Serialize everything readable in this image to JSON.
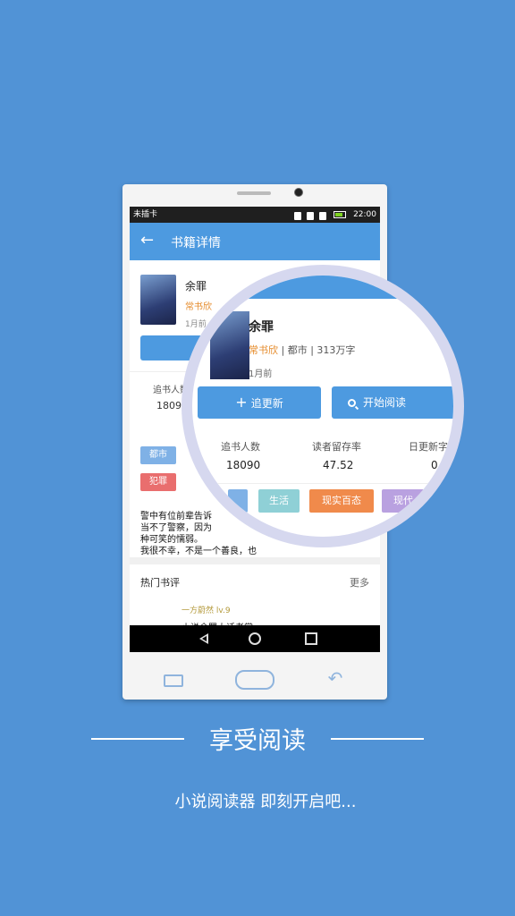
{
  "status_bar": {
    "carrier": "未插卡",
    "time": "22:00"
  },
  "app_bar": {
    "back_icon": "arrow-left-icon",
    "title": "书籍详情"
  },
  "book": {
    "title": "余罪",
    "author": "常书欣",
    "genre": "都市",
    "length": "313万字",
    "updated": "1月前",
    "stats": [
      {
        "label": "追书人数",
        "value": "18090"
      },
      {
        "label": "读者留存率",
        "value": "47.52"
      },
      {
        "label": "日更新字",
        "value": "0"
      }
    ],
    "tags": [
      {
        "label": "都市",
        "color": "#7fb1e6"
      },
      {
        "label": "犯罪",
        "color": "#e96e6e"
      },
      {
        "label": "生活",
        "color": "#8fd0d6"
      },
      {
        "label": "现实百态",
        "color": "#f08a4b"
      },
      {
        "label": "现代",
        "color": "#b9a1e0"
      }
    ],
    "description": [
      "警中有位前辈告诉",
      "当不了警察，因为",
      "种可笑的懦弱。",
      "我很不幸，不是一个善良，也"
    ]
  },
  "buttons": {
    "follow": "追更新",
    "read": "开始阅读"
  },
  "hot_reviews": {
    "title": "热门书评",
    "more": "更多",
    "first_review": {
      "user": "一方蔚然 lv.9",
      "title": "小说余罪大话老掌"
    }
  },
  "promo": {
    "headline": "享受阅读",
    "subtitle": "小说阅读器 即刻开启吧..."
  }
}
